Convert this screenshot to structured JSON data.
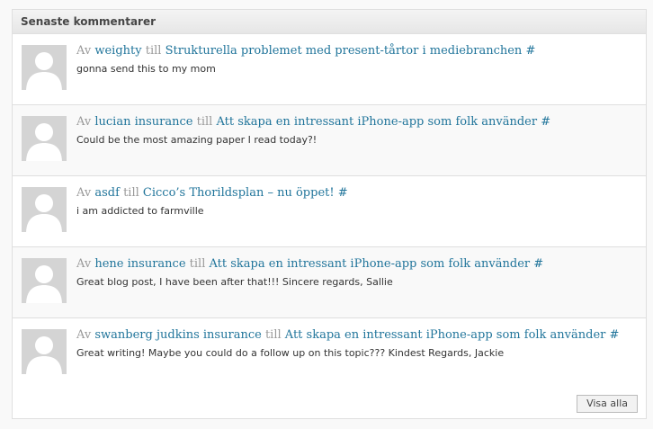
{
  "widget": {
    "title": "Senaste kommentarer",
    "view_all_label": "Visa alla"
  },
  "comments": [
    {
      "by_word": "Av",
      "author": "weighty",
      "to_word": "till",
      "post": "Strukturella problemet med present-tårtor i mediebranchen",
      "permalink": "#",
      "text": "gonna send this to my mom"
    },
    {
      "by_word": "Av",
      "author": "lucian insurance",
      "to_word": "till",
      "post": "Att skapa en intressant iPhone-app som folk använder",
      "permalink": "#",
      "text": "Could be the most amazing paper I read today?!"
    },
    {
      "by_word": "Av",
      "author": "asdf",
      "to_word": "till",
      "post": "Cicco’s Thorildsplan – nu öppet!",
      "permalink": "#",
      "text": "i am addicted to farmville"
    },
    {
      "by_word": "Av",
      "author": "hene insurance",
      "to_word": "till",
      "post": "Att skapa en intressant iPhone-app som folk använder",
      "permalink": "#",
      "text": "Great blog post, I have been after that!!! Sincere regards, Sallie"
    },
    {
      "by_word": "Av",
      "author": "swanberg judkins insurance",
      "to_word": "till",
      "post": "Att skapa en intressant iPhone-app som folk använder",
      "permalink": "#",
      "text": "Great writing! Maybe you could do a follow up on this topic??? Kindest Regards, Jackie"
    }
  ]
}
